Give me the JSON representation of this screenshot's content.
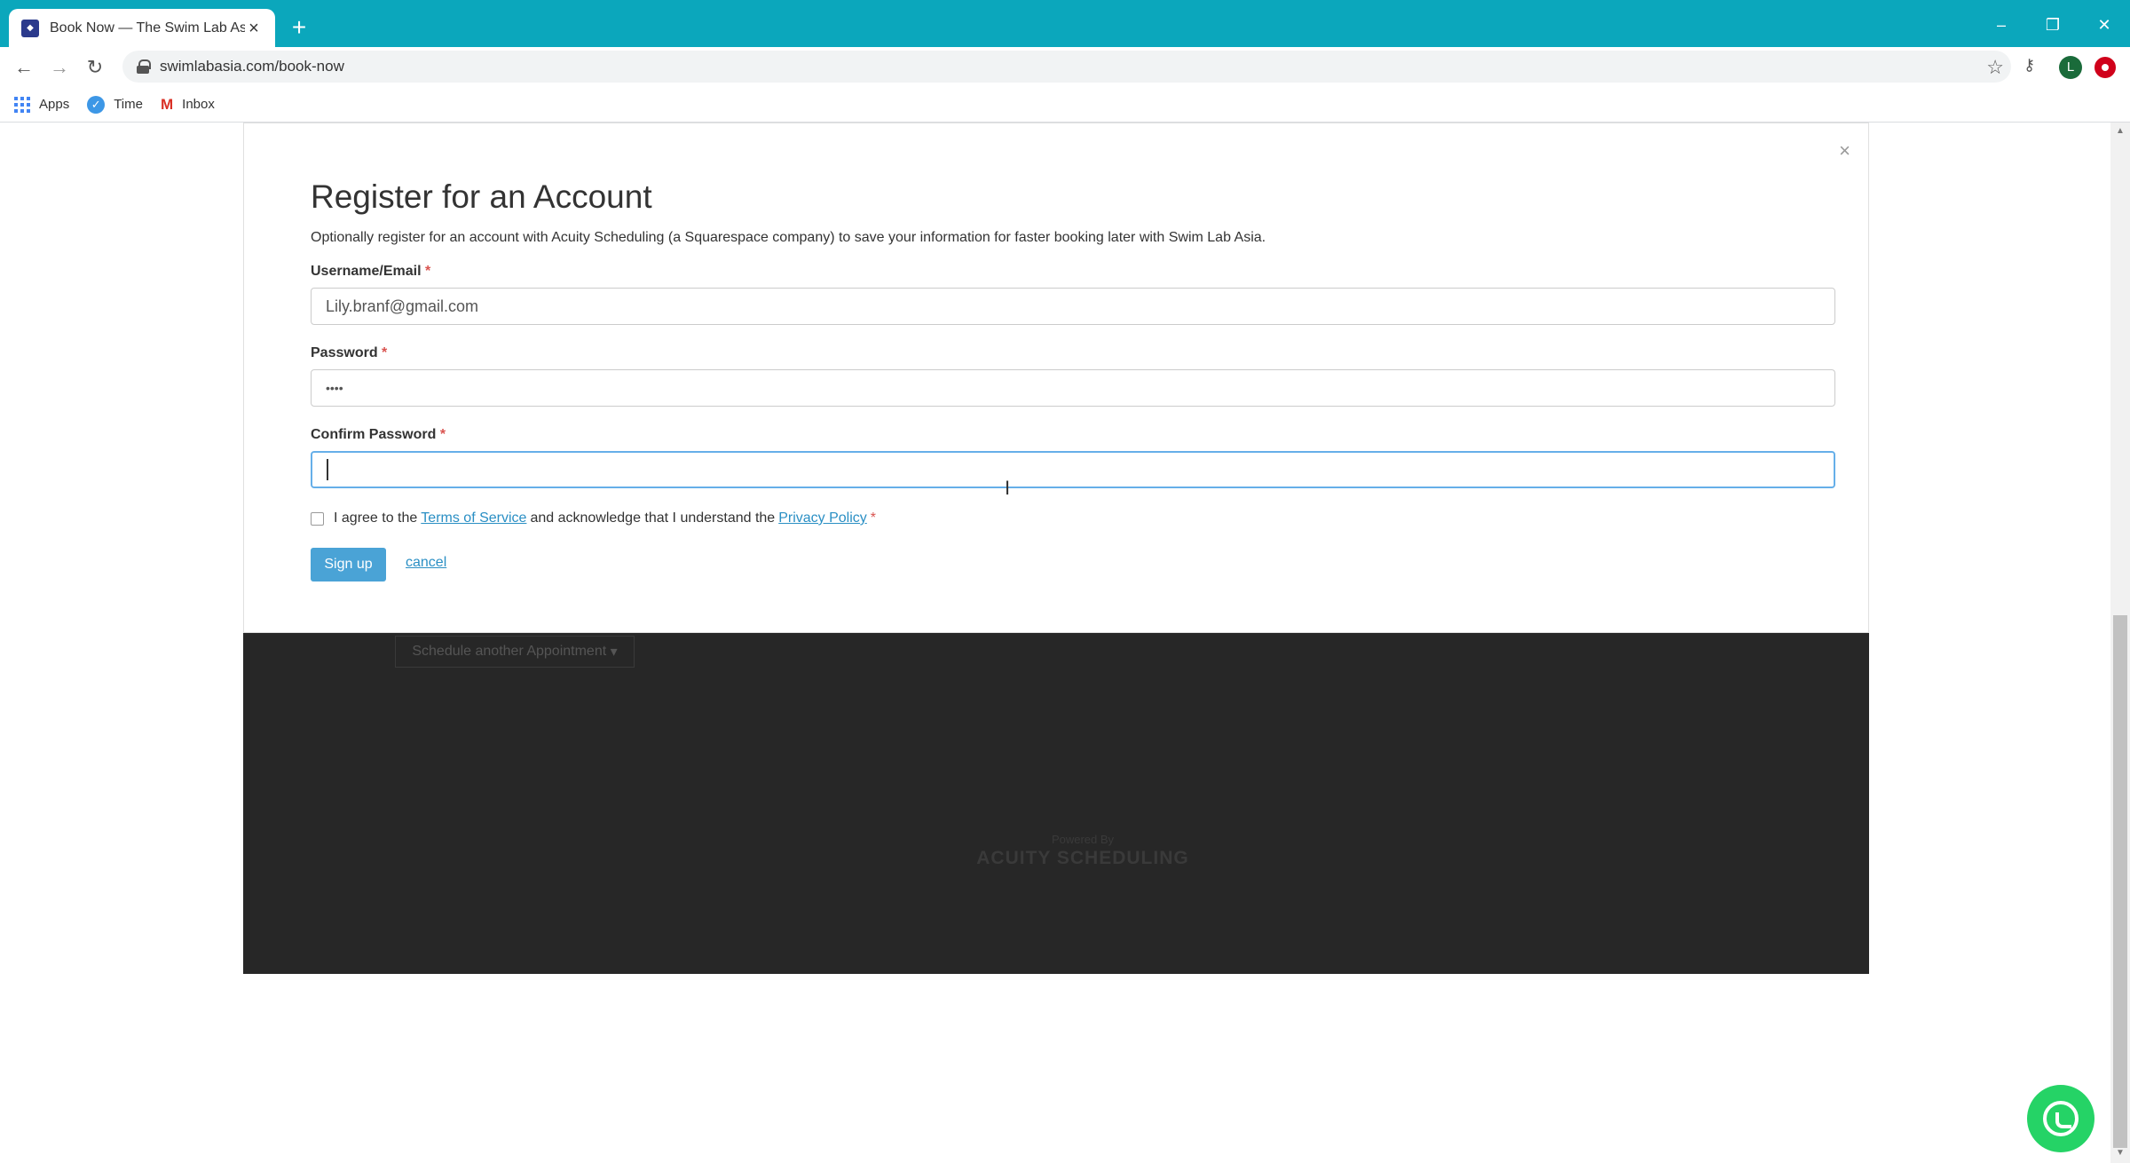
{
  "browser": {
    "tab_title": "Book Now — The Swim Lab Asia",
    "tab_close": "×",
    "new_tab": "+",
    "url": "swimlabasia.com/book-now",
    "avatar_letter": "L",
    "window_controls": {
      "minimize": "–",
      "restore": "❐",
      "close": "✕"
    },
    "bookmarks": [
      {
        "label": "Apps",
        "icon": "apps-icon"
      },
      {
        "label": "Time",
        "icon": "check-icon"
      },
      {
        "label": "Inbox",
        "icon": "gmail-icon"
      }
    ]
  },
  "modal": {
    "close": "×",
    "title": "Register for an Account",
    "description": "Optionally register for an account with Acuity Scheduling (a Squarespace company) to save your information for faster booking later with Swim Lab Asia.",
    "username_label": "Username/Email",
    "username_value": "Lily.branf@gmail.com",
    "password_label": "Password",
    "password_value": "••••",
    "confirm_label": "Confirm Password",
    "confirm_value": "",
    "required_mark": "*",
    "agree_prefix": "I agree to the",
    "terms_link": "Terms of Service",
    "agree_middle": "and acknowledge that I understand the",
    "privacy_link": "Privacy Policy",
    "signup_label": "Sign up",
    "cancel_label": "cancel"
  },
  "background": {
    "schedule_another": "Schedule another Appointment",
    "powered_by": "Powered By",
    "acuity": "ACUITY SCHEDULING"
  },
  "colors": {
    "tab_strip": "#0ba7bc",
    "signup_button": "#4aa3d6",
    "link": "#2a8fc4",
    "whatsapp": "#25d366"
  }
}
